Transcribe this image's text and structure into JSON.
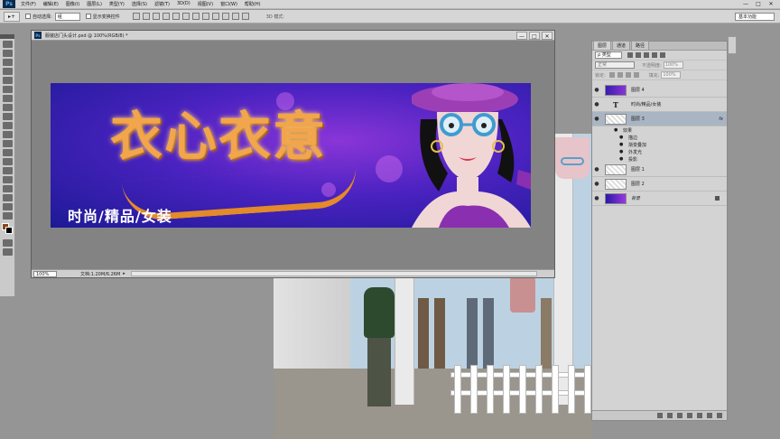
{
  "app": {
    "logo": "Ps",
    "menu": [
      "文件(F)",
      "编辑(E)",
      "图像(I)",
      "图层(L)",
      "类型(Y)",
      "选择(S)",
      "滤镜(T)",
      "3D(D)",
      "视图(V)",
      "窗口(W)",
      "帮助(H)"
    ],
    "window_controls": [
      "—",
      "□",
      "✕"
    ]
  },
  "options": {
    "tool_glyph": "▸+",
    "auto_select_label": "自动选择:",
    "auto_select_value": "组",
    "show_transform_label": "显示变换控件",
    "mode3d_label": "3D 模式:",
    "workspace": "基本功能"
  },
  "document": {
    "title": "服装店门头设计.psd @ 100%(RGB/8) *",
    "zoom": "100%",
    "info": "文档:1.20M/6.26M",
    "controls": [
      "—",
      "□",
      "✕"
    ]
  },
  "banner": {
    "brand_text": "衣心衣意",
    "slogan": "时尚/精品/女装"
  },
  "layers_panel": {
    "tabs": [
      "图层",
      "通道",
      "路径"
    ],
    "filter_label": "ρ 类型",
    "blend_mode": "正常",
    "opacity_label": "不透明度:",
    "opacity_value": "100%",
    "lock_label": "锁定:",
    "fill_label": "填充:",
    "fill_value": "100%",
    "layers": [
      {
        "name": "图层 4",
        "thumb": "brand",
        "eye": "👁"
      },
      {
        "name": "时尚/精品/女装",
        "thumb": "text",
        "glyph": "T",
        "eye": "👁"
      },
      {
        "name": "图层 3",
        "thumb": "trans",
        "eye": "👁",
        "fx": "fx"
      },
      {
        "name": "图层 1",
        "thumb": "trans",
        "eye": "👁"
      },
      {
        "name": "图层 2",
        "thumb": "trans",
        "eye": "👁"
      },
      {
        "name": "背景",
        "thumb": "bg",
        "eye": "👁"
      }
    ],
    "effects_header": "效果",
    "effects": [
      "描边",
      "渐变叠加",
      "外发光",
      "投影"
    ]
  }
}
